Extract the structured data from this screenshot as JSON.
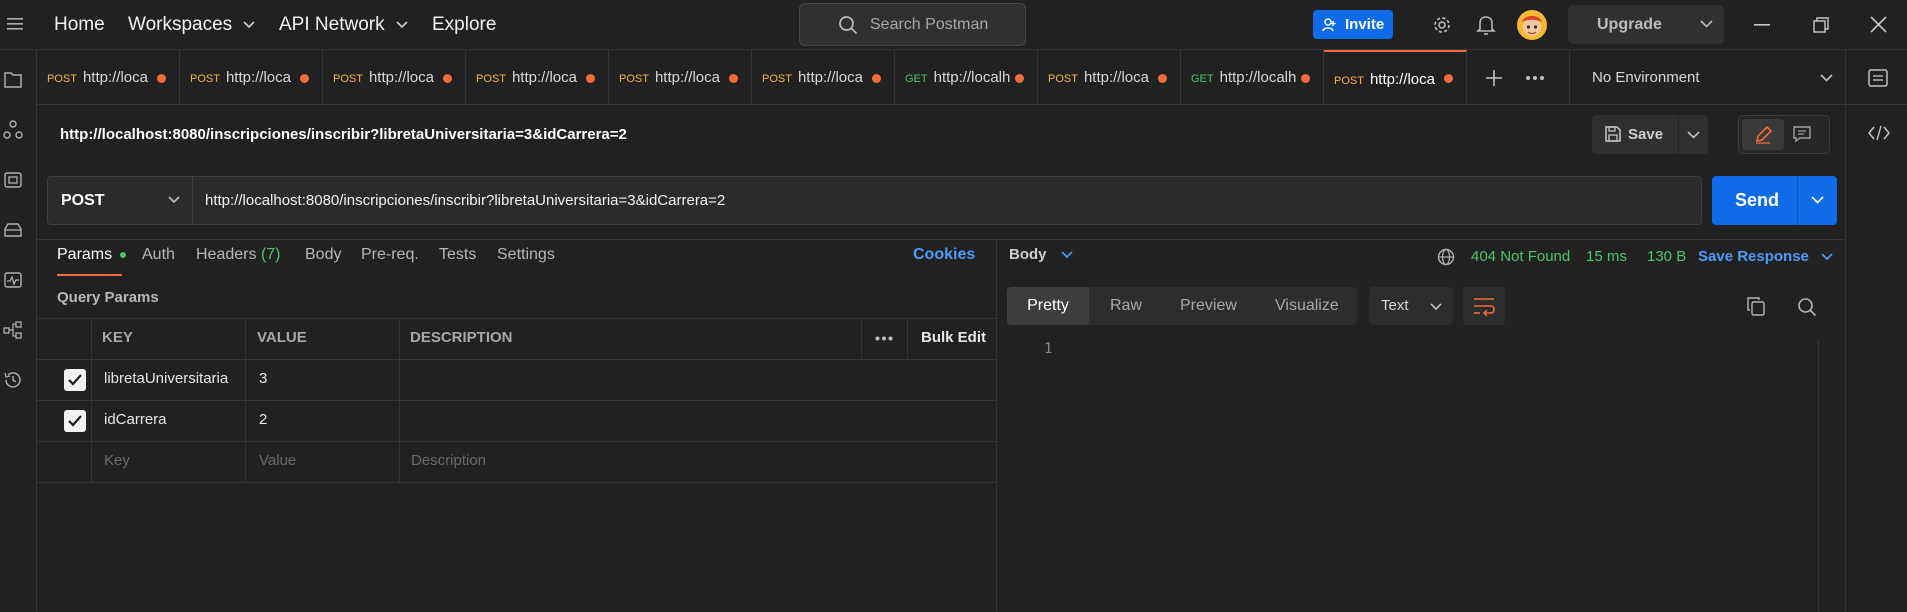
{
  "topnav": {
    "home": "Home",
    "workspaces": "Workspaces",
    "api_network": "API Network",
    "explore": "Explore",
    "search_placeholder": "Search Postman",
    "invite": "Invite",
    "upgrade": "Upgrade"
  },
  "tabs": [
    {
      "method": "POST",
      "url": "http://loca"
    },
    {
      "method": "POST",
      "url": "http://loca"
    },
    {
      "method": "POST",
      "url": "http://loca"
    },
    {
      "method": "POST",
      "url": "http://loca"
    },
    {
      "method": "POST",
      "url": "http://loca"
    },
    {
      "method": "POST",
      "url": "http://loca"
    },
    {
      "method": "GET",
      "url": "http://localh"
    },
    {
      "method": "POST",
      "url": "http://loca"
    },
    {
      "method": "GET",
      "url": "http://localh"
    },
    {
      "method": "POST",
      "url": "http://loca"
    }
  ],
  "environment": "No Environment",
  "request": {
    "title": "http://localhost:8080/inscripciones/inscribir?libretaUniversitaria=3&idCarrera=2",
    "save": "Save",
    "method": "POST",
    "url": "http://localhost:8080/inscripciones/inscribir?libretaUniversitaria=3&idCarrera=2",
    "send": "Send"
  },
  "request_tabs": {
    "params": "Params",
    "auth": "Auth",
    "headers": "Headers",
    "headers_count": "(7)",
    "body": "Body",
    "prereq": "Pre-req.",
    "tests": "Tests",
    "settings": "Settings",
    "cookies": "Cookies"
  },
  "query_params": {
    "heading": "Query Params",
    "col_key": "KEY",
    "col_value": "VALUE",
    "col_description": "DESCRIPTION",
    "bulk_edit": "Bulk Edit",
    "rows": [
      {
        "key": "libretaUniversitaria",
        "value": "3",
        "checked": true
      },
      {
        "key": "idCarrera",
        "value": "2",
        "checked": true
      }
    ],
    "placeholder_key": "Key",
    "placeholder_value": "Value",
    "placeholder_description": "Description"
  },
  "response": {
    "body_label": "Body",
    "status": "404 Not Found",
    "time": "15 ms",
    "size": "130 B",
    "save_response": "Save Response",
    "tabs": [
      "Pretty",
      "Raw",
      "Preview",
      "Visualize"
    ],
    "format": "Text",
    "line_number": "1"
  },
  "colors": {
    "accent_orange": "#f26b3a",
    "primary_blue": "#0f6be8",
    "status_green": "#4cc66a",
    "link_blue": "#4d9cf8",
    "post_method": "#f9b34a"
  }
}
